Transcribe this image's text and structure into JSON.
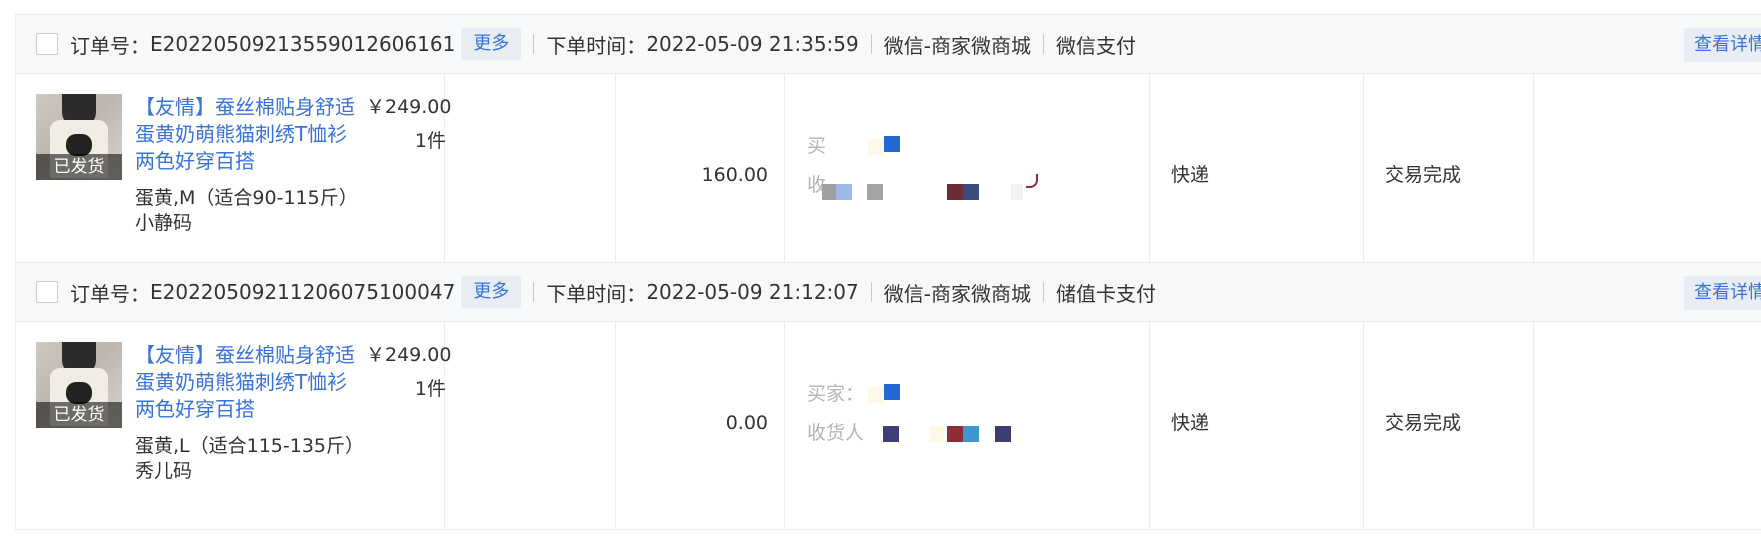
{
  "orders": [
    {
      "order_no_label": "订单号：",
      "order_no": "E20220509213559012606161",
      "more": "更多",
      "time_label": "下单时间：",
      "time": "2022-05-09 21:35:59",
      "channel": "微信-商家微商城",
      "payment": "微信支付",
      "detail": "查看详情",
      "product": {
        "status_badge": "已发货",
        "title": "【友情】蚕丝棉贴身舒适蛋黄奶萌熊猫刺绣T恤衫 两色好穿百搭",
        "sku": "蛋黄,M（适合90-115斤）",
        "sku_note": "小静码",
        "price": "￥249.00",
        "quantity": "1件"
      },
      "amount": "160.00",
      "buyer_label": "买",
      "receiver_label": "收",
      "shipping": "快递",
      "status": "交易完成"
    },
    {
      "order_no_label": "订单号：",
      "order_no": "E20220509211206075100047",
      "more": "更多",
      "time_label": "下单时间：",
      "time": "2022-05-09 21:12:07",
      "channel": "微信-商家微商城",
      "payment": "储值卡支付",
      "detail": "查看详情",
      "product": {
        "status_badge": "已发货",
        "title": "【友情】蚕丝棉贴身舒适蛋黄奶萌熊猫刺绣T恤衫 两色好穿百搭",
        "sku": "蛋黄,L（适合115-135斤）",
        "sku_note": "秀儿码",
        "price": "￥249.00",
        "quantity": "1件"
      },
      "amount": "0.00",
      "buyer_label": "买家：",
      "receiver_label": "收货人",
      "shipping": "快递",
      "status": "交易完成"
    }
  ],
  "colors": {
    "link": "#3773da",
    "header_bg": "#f7f8fa",
    "button_bg": "#e8ecf3",
    "border": "#ebedf0"
  }
}
